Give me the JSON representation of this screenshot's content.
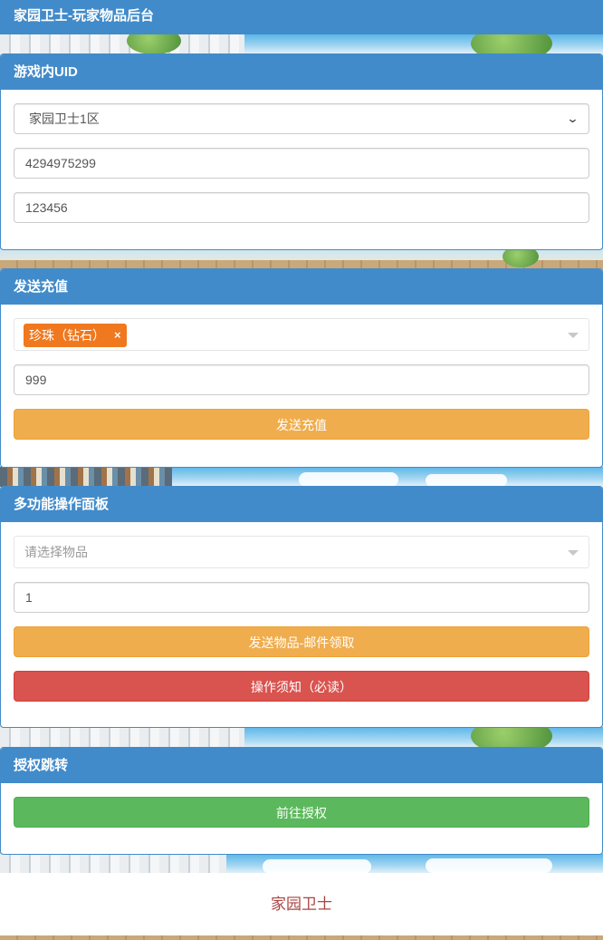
{
  "header": {
    "title": "家园卫士-玩家物品后台"
  },
  "uid_panel": {
    "heading": "游戏内UID",
    "server_select": {
      "selected": "家园卫士1区"
    },
    "uid_input": {
      "value": "4294975299"
    },
    "password_input": {
      "value": "123456"
    }
  },
  "recharge_panel": {
    "heading": "发送充值",
    "item_select": {
      "selected_tag": "珍珠（钻石）",
      "remove_symbol": "×"
    },
    "amount_input": {
      "value": "999"
    },
    "send_button": "发送充值"
  },
  "multi_panel": {
    "heading": "多功能操作面板",
    "item_select": {
      "placeholder": "请选择物品"
    },
    "quantity_input": {
      "value": "1"
    },
    "send_mail_button": "发送物品-邮件领取",
    "notice_button": "操作须知（必读）"
  },
  "auth_panel": {
    "heading": "授权跳转",
    "goto_button": "前往授权"
  },
  "footer": {
    "text": "家园卫士"
  },
  "colors": {
    "primary": "#428bca",
    "warning": "#f0ad4e",
    "danger": "#d9534f",
    "success": "#5cb85c",
    "tag": "#f0781e",
    "footer_text": "#a94442"
  }
}
